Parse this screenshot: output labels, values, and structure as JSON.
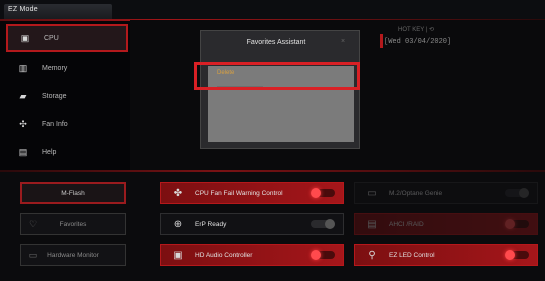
{
  "header": {
    "mode_label": "EZ Mode"
  },
  "sidebar": {
    "items": [
      {
        "label": "CPU",
        "icon": "cpu-icon"
      },
      {
        "label": "Memory",
        "icon": "memory-icon"
      },
      {
        "label": "Storage",
        "icon": "storage-icon"
      },
      {
        "label": "Fan Info",
        "icon": "fan-icon"
      },
      {
        "label": "Help",
        "icon": "help-icon"
      }
    ]
  },
  "status": {
    "hotkey": "HOT KEY  |  ⟲",
    "date": "[Wed  03/04/2020]"
  },
  "favorites_dialog": {
    "title": "Favorites Assistant",
    "close": "×",
    "option_selected": "Delete"
  },
  "bottom_buttons": [
    {
      "label": "M-Flash",
      "icon": "flash-icon"
    },
    {
      "label": "Favorites",
      "icon": "heart-icon"
    },
    {
      "label": "Hardware Monitor",
      "icon": "monitor-icon"
    }
  ],
  "features": {
    "cpu_fan": {
      "label": "CPU Fan Fail Warning Control",
      "icon": "fan-icon",
      "state": "on"
    },
    "erp": {
      "label": "ErP Ready",
      "icon": "erp-icon",
      "state": "off"
    },
    "hd_audio": {
      "label": "HD Audio Controller",
      "icon": "audio-icon",
      "state": "on"
    },
    "m2": {
      "label": "M.2/Optane Genie",
      "icon": "m2-icon",
      "state": "off"
    },
    "ahci": {
      "label": "AHCI /RAID",
      "icon": "ahci-icon",
      "state": "on"
    },
    "ez_led": {
      "label": "EZ LED Control",
      "icon": "led-icon",
      "state": "on"
    }
  },
  "colors": {
    "accent": "#b3191c",
    "highlight_box": "#d92025",
    "option_text": "#d8a040"
  }
}
